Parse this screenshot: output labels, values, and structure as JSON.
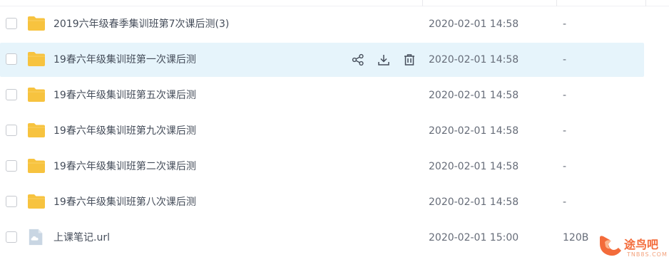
{
  "files": [
    {
      "name": "2019六年级春季集训班第7次课后测(3)",
      "date": "2020-02-01 14:58",
      "size": "-",
      "icon": "folder-icon"
    },
    {
      "name": "19春六年级集训班第一次课后测",
      "date": "2020-02-01 14:58",
      "size": "-",
      "icon": "folder-icon"
    },
    {
      "name": "19春六年级集训班第五次课后测",
      "date": "2020-02-01 14:58",
      "size": "-",
      "icon": "folder-icon"
    },
    {
      "name": "19春六年级集训班第九次课后测",
      "date": "2020-02-01 14:58",
      "size": "-",
      "icon": "folder-icon"
    },
    {
      "name": "19春六年级集训班第二次课后测",
      "date": "2020-02-01 14:58",
      "size": "-",
      "icon": "folder-icon"
    },
    {
      "name": "19春六年级集训班第八次课后测",
      "date": "2020-02-01 14:58",
      "size": "-",
      "icon": "folder-icon"
    },
    {
      "name": "上课笔记.url",
      "date": "2020-02-01 15:00",
      "size": "120B",
      "icon": "url-file-icon"
    }
  ],
  "hovered_row_actions": [
    "share-icon",
    "download-icon",
    "delete-icon"
  ],
  "watermark": {
    "main": "途鸟吧",
    "sub": "TNB8S.COM"
  },
  "colors": {
    "folder": "#f7c33f",
    "hover_bg": "#e6f4fb",
    "action_icon": "#454d5a",
    "watermark": "#f36b3a"
  }
}
